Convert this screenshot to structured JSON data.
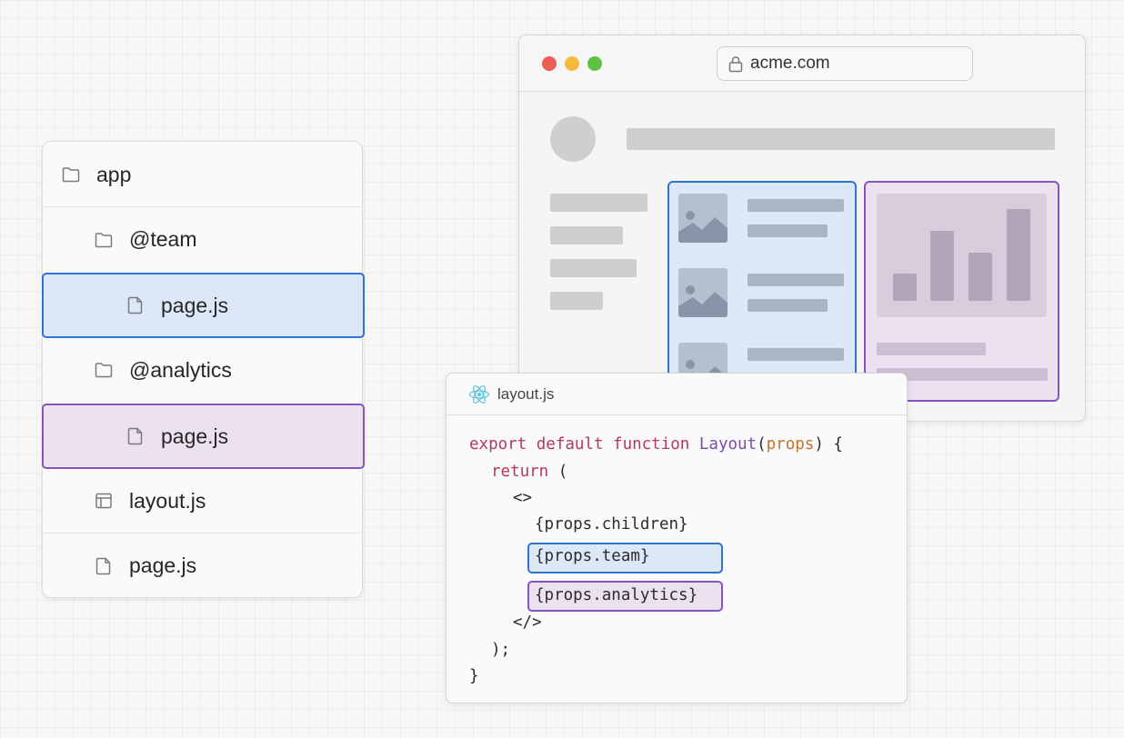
{
  "tree": {
    "items": [
      {
        "label": "app",
        "icon": "folder-icon"
      },
      {
        "label": "@team",
        "icon": "folder-icon"
      },
      {
        "label": "page.js",
        "icon": "file-icon",
        "highlight": "blue"
      },
      {
        "label": "@analytics",
        "icon": "folder-icon"
      },
      {
        "label": "page.js",
        "icon": "file-icon",
        "highlight": "purple"
      },
      {
        "label": "layout.js",
        "icon": "layout-icon"
      },
      {
        "label": "page.js",
        "icon": "file-icon"
      }
    ]
  },
  "browser": {
    "url": "acme.com"
  },
  "code": {
    "filename": "layout.js",
    "lines": {
      "l1_kw": "export default function ",
      "l1_fn": "Layout",
      "l1_open": "(",
      "l1_param": "props",
      "l1_close": ") {",
      "l2_kw": "return",
      "l2_rest": " (",
      "l3": "<>",
      "l4": "{props.children}",
      "l5": "{props.team}",
      "l6": "{props.analytics}",
      "l7": "</>",
      "l8": ");",
      "l9": "}"
    }
  },
  "colors": {
    "team": "#2e74d3",
    "team_fill": "#dce8f8",
    "analytics": "#8454c2",
    "analytics_fill": "#ece1f1",
    "keyword": "#b5395b",
    "function": "#7c4dab",
    "param": "#c2712b"
  }
}
